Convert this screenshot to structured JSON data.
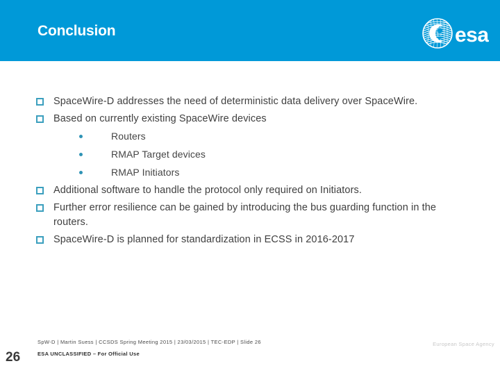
{
  "slide": {
    "title": "Conclusion",
    "number": "26",
    "header_color": "#0099d8",
    "title_color": "#ffffff",
    "body_text_color": "#3f3f3f",
    "marker_color": "#3b9fbe"
  },
  "logo": {
    "wordmark": "esa",
    "emblem_name": "esa-emblem-icon"
  },
  "bullets": [
    {
      "level": 1,
      "marker": "hollow-square",
      "text": "SpaceWire-D addresses the need of deterministic data delivery over SpaceWire."
    },
    {
      "level": 1,
      "marker": "hollow-square",
      "text": "Based on currently existing SpaceWire devices"
    },
    {
      "level": 2,
      "marker": "dot",
      "text": "Routers"
    },
    {
      "level": 2,
      "marker": "dot",
      "text": "RMAP Target devices"
    },
    {
      "level": 2,
      "marker": "dot",
      "text": "RMAP Initiators"
    },
    {
      "level": 1,
      "marker": "hollow-square",
      "text": "Additional software to handle the protocol only required on Initiators."
    },
    {
      "level": 1,
      "marker": "hollow-square",
      "text": "Further error resilience can be gained by introducing the bus guarding function in the routers."
    },
    {
      "level": 1,
      "marker": "hollow-square",
      "text": "SpaceWire-D is planned for standardization in ECSS in 2016-2017"
    }
  ],
  "footer": {
    "line1": "SpW-D | Martin Suess | CCSDS Spring Meeting 2015 | 23/03/2015 | TEC-EDP | Slide  26",
    "line2": "ESA UNCLASSIFIED – For Official Use",
    "agency": "European Space Agency"
  }
}
